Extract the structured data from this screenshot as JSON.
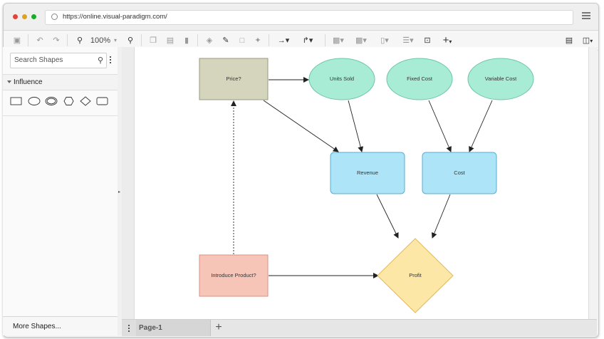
{
  "browser": {
    "url": "https://online.visual-paradigm.com/",
    "dot_colors": [
      "#e0443e",
      "#dea123",
      "#1aab29"
    ]
  },
  "toolbar": {
    "zoom_label": "100%",
    "icons": [
      "save-icon",
      "undo-icon",
      "redo-icon",
      "zoom-out-icon",
      "zoom-in-icon",
      "copy-icon",
      "paste-icon",
      "delete-icon",
      "fill-color-icon",
      "line-color-icon",
      "shadow-icon",
      "format-painter-icon",
      "connector-icon",
      "waypoint-icon",
      "to-front-icon",
      "to-back-icon",
      "align-icon",
      "distribute-icon",
      "group-icon",
      "add-icon",
      "panel-toggle-icon",
      "layout-icon"
    ]
  },
  "sidebar": {
    "search_placeholder": "Search Shapes",
    "section_label": "Influence",
    "shape_icons": [
      "rectangle-shape-icon",
      "ellipse-shape-icon",
      "double-ellipse-shape-icon",
      "hexagon-shape-icon",
      "diamond-shape-icon",
      "rounded-rectangle-shape-icon"
    ],
    "more_shapes": "More Shapes..."
  },
  "diagram": {
    "nodes": {
      "price": "Price?",
      "units_sold": "Units Sold",
      "fixed_cost": "Fixed Cost",
      "variable_cost": "Variable Cost",
      "revenue": "Revenue",
      "cost": "Cost",
      "introduce_product": "Introduce Product?",
      "profit": "Profit"
    },
    "colors": {
      "decision_fill": "#d5d4bd",
      "decision_stroke": "#9a9a80",
      "chance_fill": "#a8ecd5",
      "chance_stroke": "#6cc7a6",
      "value_fill": "#aee4f7",
      "value_stroke": "#5aaecf",
      "intro_fill": "#f7c4b8",
      "intro_stroke": "#d99282",
      "profit_fill": "#fde7a6",
      "profit_stroke": "#e2b95c"
    }
  },
  "pages": {
    "current": "Page-1"
  }
}
